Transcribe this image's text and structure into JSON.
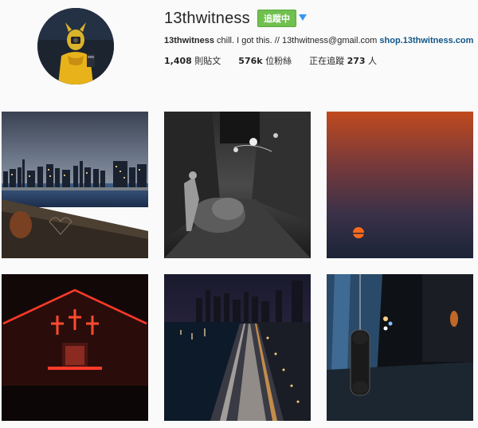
{
  "profile": {
    "username": "13thwitness",
    "follow_label": "追蹤中",
    "bio": {
      "name": "13thwitness",
      "text": " chill. I got this. // 13thwitness@gmail.com ",
      "link": "shop.13thwitness.com"
    },
    "stats": {
      "posts_count": "1,408",
      "posts_label": "則貼文",
      "followers_count": "576k",
      "followers_label": "位粉絲",
      "following_prefix": "正在追蹤",
      "following_count": "273",
      "following_suffix": "人"
    }
  },
  "colors": {
    "follow_green": "#70c050",
    "link_blue": "#125688",
    "dropdown_blue": "#3897f0"
  },
  "icons": {
    "dropdown": "triangle-down-icon"
  },
  "posts": [
    {
      "scene": "city-skyline-night-river"
    },
    {
      "scene": "street-black-white"
    },
    {
      "scene": "sunset-gradient-sun"
    },
    {
      "scene": "neon-crosses-church"
    },
    {
      "scene": "city-highway-night"
    },
    {
      "scene": "hanging-payphone-night"
    }
  ]
}
